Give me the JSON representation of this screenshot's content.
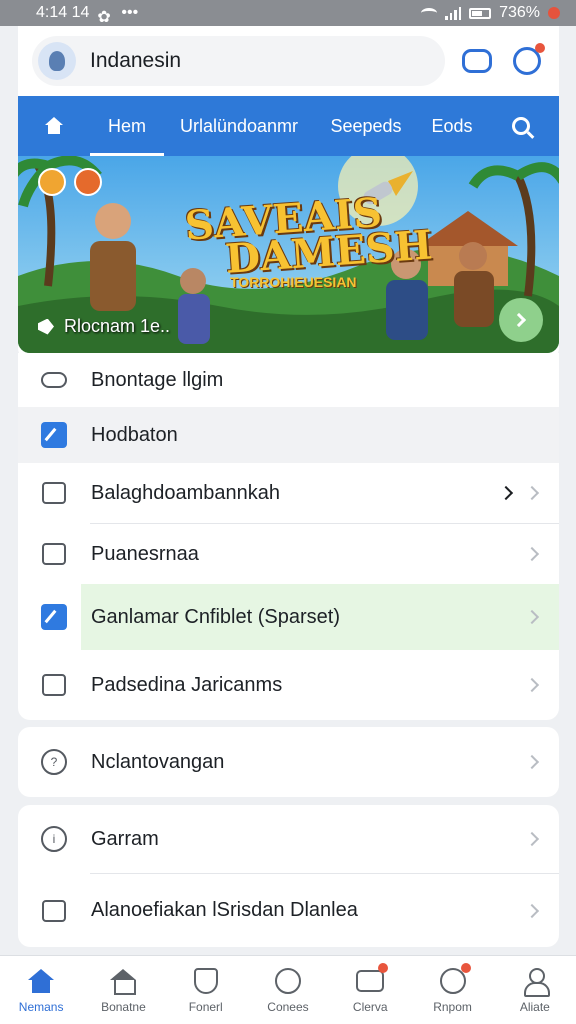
{
  "status_bar": {
    "time": "4:14 14",
    "battery": "736%"
  },
  "header": {
    "search_text": "Indanesin",
    "tabs": [
      "Hem",
      "Urlalündoanmr",
      "Seepeds",
      "Eods"
    ]
  },
  "banner": {
    "title_line1": "SAVEAIS",
    "title_line2": "DAMESH",
    "subtitle": "TORROHIEUESIAN",
    "caption": "Rlocnam 1e.."
  },
  "menu_group1": [
    {
      "label": "Bnontage llgim",
      "icon": "gamepad-icon"
    },
    {
      "label": "Hodbaton",
      "icon": "edit-icon"
    },
    {
      "label": "Balaghdoambannkah",
      "icon": "pencil-icon"
    },
    {
      "label": "Puanesrnaa",
      "icon": "list-icon"
    },
    {
      "label": "Ganlamar Cnfiblet  (Sparset)",
      "icon": "edit-icon"
    },
    {
      "label": "Padsedina Jaricanms",
      "icon": "dice-icon"
    }
  ],
  "menu_group2": [
    {
      "label": "Nclantovangan",
      "icon": "help-icon"
    }
  ],
  "menu_group3": [
    {
      "label": "Garram",
      "icon": "info-icon"
    },
    {
      "label": "Alanoefiakan lSrisdan Dlanlea",
      "icon": "calendar-icon"
    }
  ],
  "bottom_nav": [
    {
      "label": "Nemans",
      "icon": "home-icon"
    },
    {
      "label": "Bonatne",
      "icon": "home-outline-icon"
    },
    {
      "label": "Fonerl",
      "icon": "shield-icon"
    },
    {
      "label": "Conees",
      "icon": "chat-bubble-icon"
    },
    {
      "label": "Clerva",
      "icon": "message-icon"
    },
    {
      "label": "Rnpom",
      "icon": "refresh-icon"
    },
    {
      "label": "Aliate",
      "icon": "profile-icon"
    }
  ],
  "colors": {
    "accent": "#2e79d8",
    "notification": "#e8553d",
    "highlight": "#e6f6e3"
  }
}
